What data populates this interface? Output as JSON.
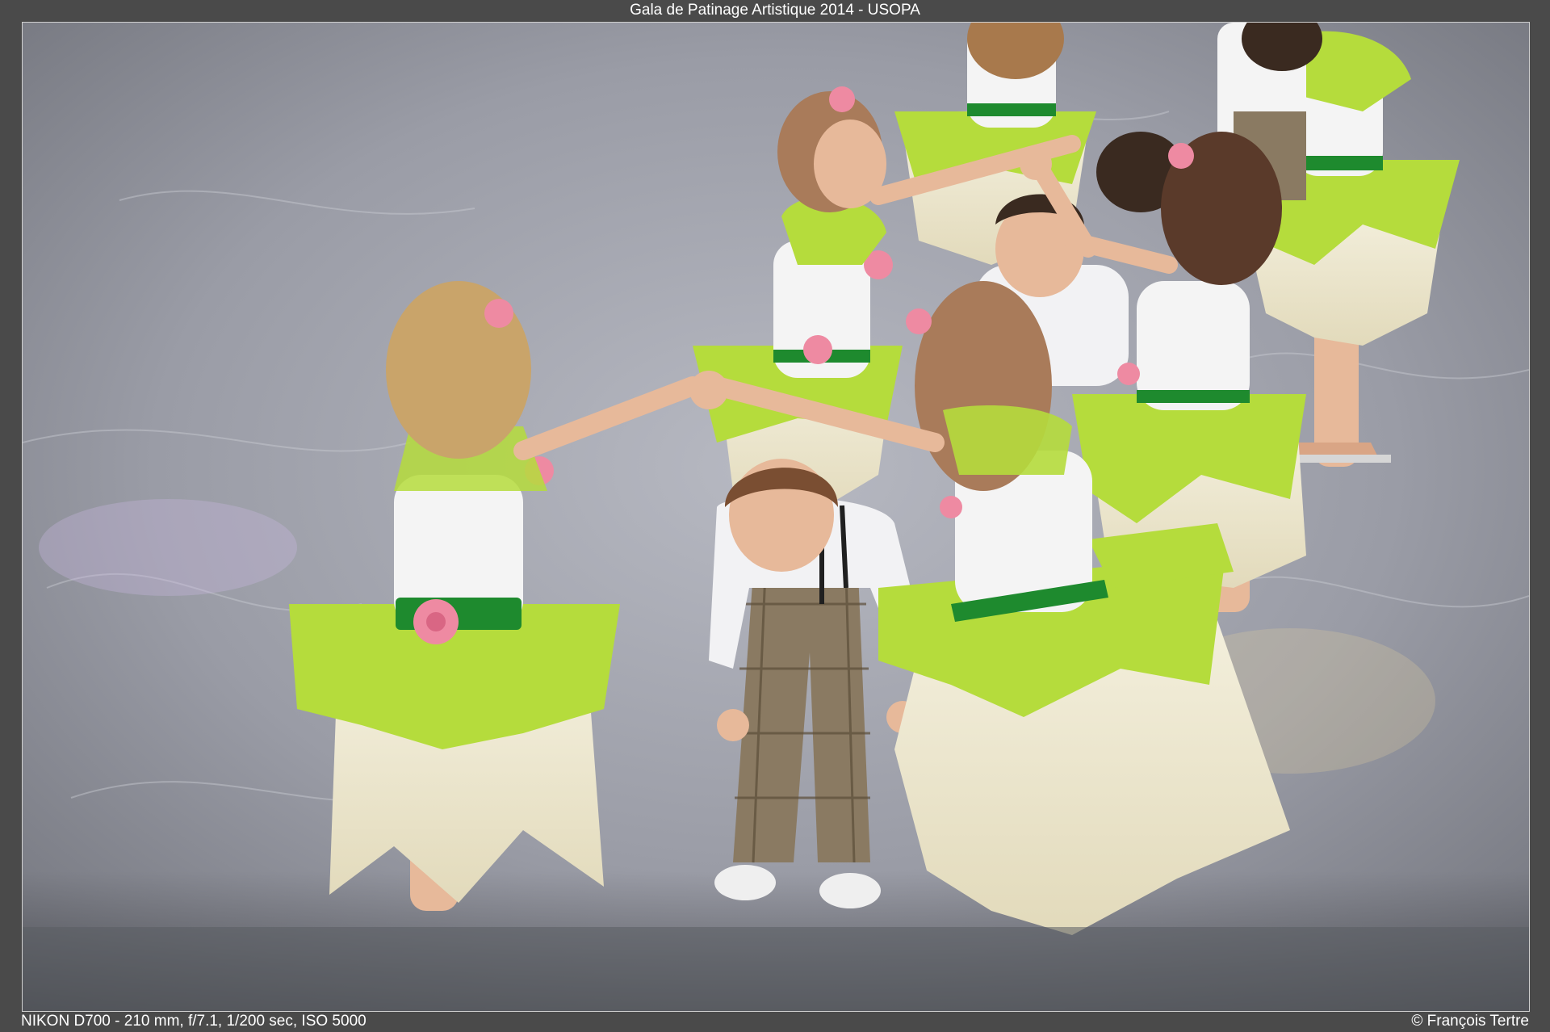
{
  "header": {
    "title": "Gala de Patinage Artistique 2014 - USOPA"
  },
  "footer": {
    "exif": "NIKON D700 - 210 mm, f/7.1, 1/200 sec, ISO 5000",
    "copyright": "© François Tertre"
  },
  "photo": {
    "colors": {
      "ice": "#8e9098",
      "ice_light": "#b3b5bd",
      "leaf_green": "#b5dc3c",
      "petal_cream": "#ece6cf",
      "top_white": "#f4f4f4",
      "sash_green": "#1e8a2e",
      "rose_pink": "#ee8aa2",
      "hair_blond": "#c9a46a",
      "hair_brown": "#6a4530",
      "skin": "#e7b99a",
      "plaid": "#8a7a62"
    }
  }
}
